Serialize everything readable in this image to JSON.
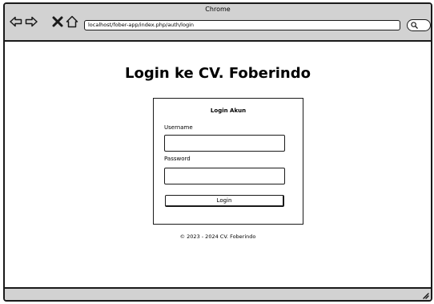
{
  "window": {
    "title": "Chrome"
  },
  "toolbar": {
    "url": "localhost/fober-app/index.php/auth/login",
    "icons": [
      "back-arrow-icon",
      "forward-arrow-icon",
      "close-icon",
      "home-icon",
      "search-icon"
    ]
  },
  "page": {
    "title": "Login ke CV. Foberindo",
    "card": {
      "title": "Login Akun",
      "username_label": "Username",
      "username_value": "",
      "password_label": "Password",
      "password_value": "",
      "login_label": "Login"
    },
    "footer": "© 2023 - 2024 CV. Foberindo"
  },
  "colors": {
    "chrome": "#d2d2d2",
    "stroke": "#1a1a1a",
    "background": "#ffffff"
  }
}
